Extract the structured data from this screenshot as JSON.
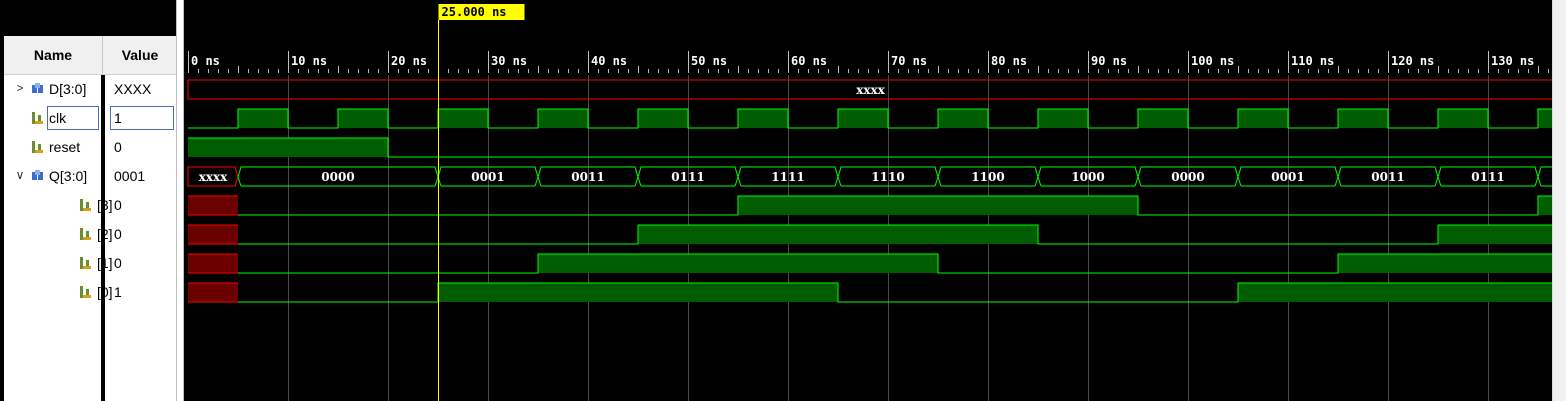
{
  "cursor": {
    "label": "25.000 ns",
    "time_ns": 25
  },
  "timeline": {
    "start_ns": 0,
    "end_ns": 136.5,
    "major_tick_ns": 10,
    "minor_tick_ns": 1,
    "tick_labels": [
      "0 ns",
      "10 ns",
      "20 ns",
      "30 ns",
      "40 ns",
      "50 ns",
      "60 ns",
      "70 ns",
      "80 ns",
      "90 ns",
      "100 ns",
      "110 ns",
      "120 ns",
      "130 ns"
    ]
  },
  "columns": {
    "name": "Name",
    "value": "Value"
  },
  "signals": [
    {
      "name": "D[3:0]",
      "value": "XXXX",
      "expander": ">",
      "icon": "bus-icon",
      "indent": 0,
      "type": "bus",
      "segments": [
        {
          "from": 0,
          "to": 136.5,
          "label": "xxxx",
          "state": "x"
        }
      ]
    },
    {
      "name": "clk",
      "value": "1",
      "icon": "bit-icon",
      "indent": 0,
      "type": "bit",
      "selected": true,
      "transitions": [
        [
          0,
          0
        ],
        [
          5,
          1
        ],
        [
          10,
          0
        ],
        [
          15,
          1
        ],
        [
          20,
          0
        ],
        [
          25,
          1
        ],
        [
          30,
          0
        ],
        [
          35,
          1
        ],
        [
          40,
          0
        ],
        [
          45,
          1
        ],
        [
          50,
          0
        ],
        [
          55,
          1
        ],
        [
          60,
          0
        ],
        [
          65,
          1
        ],
        [
          70,
          0
        ],
        [
          75,
          1
        ],
        [
          80,
          0
        ],
        [
          85,
          1
        ],
        [
          90,
          0
        ],
        [
          95,
          1
        ],
        [
          100,
          0
        ],
        [
          105,
          1
        ],
        [
          110,
          0
        ],
        [
          115,
          1
        ],
        [
          120,
          0
        ],
        [
          125,
          1
        ],
        [
          130,
          0
        ],
        [
          135,
          1
        ]
      ]
    },
    {
      "name": "reset",
      "value": "0",
      "icon": "bit-icon",
      "indent": 0,
      "type": "bit",
      "transitions": [
        [
          0,
          1
        ],
        [
          20,
          0
        ]
      ]
    },
    {
      "name": "Q[3:0]",
      "value": "0001",
      "expander": "∨",
      "icon": "bus-icon",
      "indent": 0,
      "type": "bus",
      "segments": [
        {
          "from": 0,
          "to": 5,
          "label": "xxxx",
          "state": "x"
        },
        {
          "from": 5,
          "to": 25,
          "label": "0000"
        },
        {
          "from": 25,
          "to": 35,
          "label": "0001"
        },
        {
          "from": 35,
          "to": 45,
          "label": "0011"
        },
        {
          "from": 45,
          "to": 55,
          "label": "0111"
        },
        {
          "from": 55,
          "to": 65,
          "label": "1111"
        },
        {
          "from": 65,
          "to": 75,
          "label": "1110"
        },
        {
          "from": 75,
          "to": 85,
          "label": "1100"
        },
        {
          "from": 85,
          "to": 95,
          "label": "1000"
        },
        {
          "from": 95,
          "to": 105,
          "label": "0000"
        },
        {
          "from": 105,
          "to": 115,
          "label": "0001"
        },
        {
          "from": 115,
          "to": 125,
          "label": "0011"
        },
        {
          "from": 125,
          "to": 135,
          "label": "0111"
        },
        {
          "from": 135,
          "to": 136.5,
          "label": ""
        }
      ]
    },
    {
      "name": "[3]",
      "value": "0",
      "icon": "bit-icon",
      "indent": 1,
      "type": "bit",
      "transitions": [
        [
          0,
          "x"
        ],
        [
          5,
          0
        ],
        [
          55,
          1
        ],
        [
          95,
          0
        ],
        [
          135,
          1
        ]
      ]
    },
    {
      "name": "[2]",
      "value": "0",
      "icon": "bit-icon",
      "indent": 1,
      "type": "bit",
      "transitions": [
        [
          0,
          "x"
        ],
        [
          5,
          0
        ],
        [
          45,
          1
        ],
        [
          85,
          0
        ],
        [
          125,
          1
        ]
      ]
    },
    {
      "name": "[1]",
      "value": "0",
      "icon": "bit-icon",
      "indent": 1,
      "type": "bit",
      "transitions": [
        [
          0,
          "x"
        ],
        [
          5,
          0
        ],
        [
          35,
          1
        ],
        [
          75,
          0
        ],
        [
          115,
          1
        ]
      ]
    },
    {
      "name": "[0]",
      "value": "1",
      "icon": "bit-icon",
      "indent": 1,
      "type": "bit",
      "transitions": [
        [
          0,
          "x"
        ],
        [
          5,
          0
        ],
        [
          25,
          1
        ],
        [
          65,
          0
        ],
        [
          105,
          1
        ]
      ]
    }
  ],
  "colors": {
    "background": "#000000",
    "wave_green": "#00ff00",
    "wave_fill": "#005c00",
    "unknown_red": "#ff0000",
    "unknown_fill": "#6b0000",
    "cursor": "#ffff00",
    "grid": "#4a4a4a",
    "ruler_text": "#ffffff",
    "bus_text": "#ffffff"
  }
}
